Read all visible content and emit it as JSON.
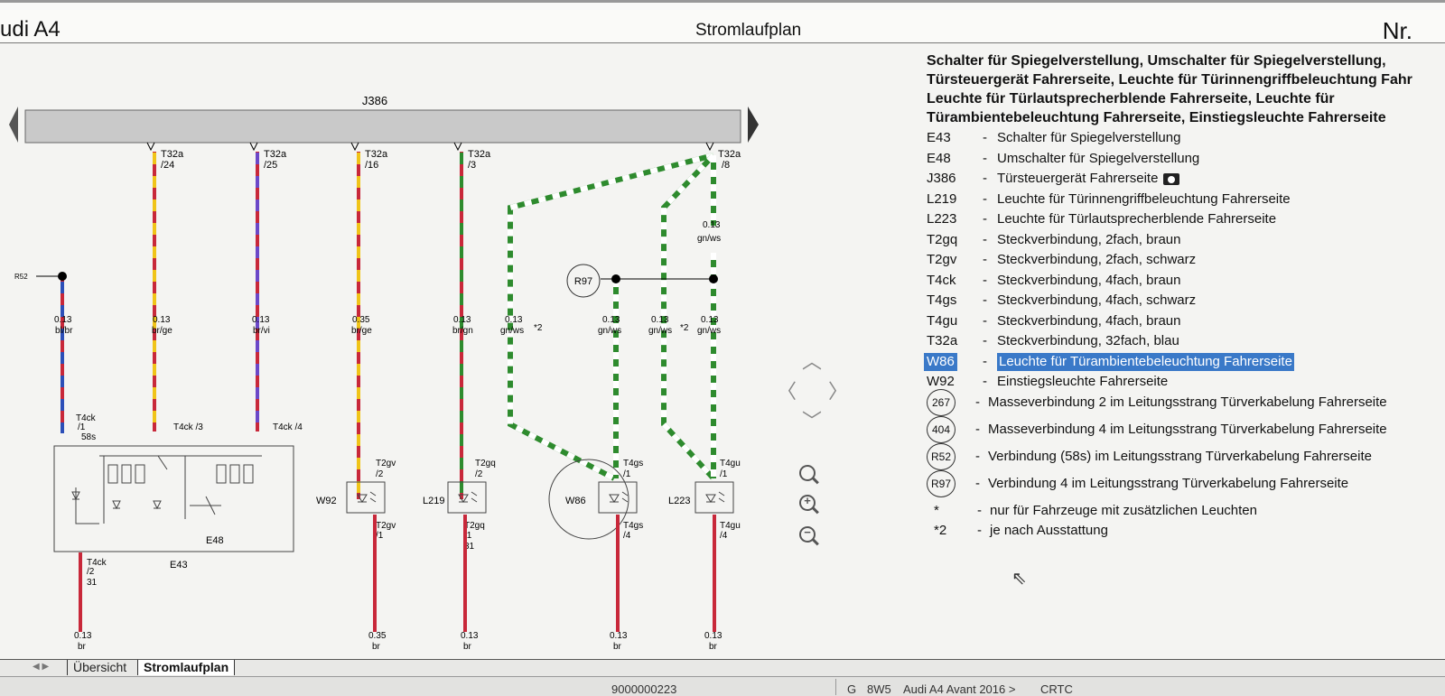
{
  "header": {
    "app_title": "udi A4",
    "doc_title": "Stromlaufplan",
    "doc_nr": "Nr."
  },
  "diagram": {
    "bus_label": "J386",
    "wires": [
      {
        "conn": "T32a",
        "pin": "/24",
        "size": "0.13",
        "color": "br/ge",
        "end": "T4ck /3"
      },
      {
        "conn": "T32a",
        "pin": "/25",
        "size": "0.13",
        "color": "br/vi",
        "end": "T4ck /4"
      },
      {
        "conn": "T32a",
        "pin": "/16",
        "size": "0.35",
        "color": "br/ge"
      },
      {
        "conn": "T32a",
        "pin": "/3",
        "size": "0.13",
        "color": "br/gn"
      },
      {
        "conn": "T32a",
        "pin": "/8"
      }
    ],
    "left_wire": {
      "ref": "R52",
      "size": "0.13",
      "color": "bl/br",
      "conn": "T4ck",
      "pin": "/1",
      "extra": "58s"
    },
    "gnws": [
      {
        "size": "0.13",
        "color": "gn/ws",
        "note": "*2"
      },
      {
        "size": "0.13",
        "color": "gn/ws"
      },
      {
        "size": "0.13",
        "color": "gn/ws",
        "note": "*2"
      },
      {
        "size": "0.13",
        "color": "gn/ws"
      }
    ],
    "top_gnws": {
      "size": "0.13",
      "color": "gn/ws"
    },
    "r97": "R97",
    "components": {
      "e43": "E43",
      "e48": "E48",
      "w92": "W92",
      "l219": "L219",
      "w86": "W86",
      "l223": "L223",
      "t2gv": "T2gv",
      "t2gq": "T2gq",
      "t4gs": "T4gs",
      "t4gu": "T4gu",
      "pin2": "/2",
      "pin1": "/1",
      "pin4": "/4",
      "pin31": "31"
    },
    "bottom_e43": {
      "conn": "T4ck",
      "pin": "/2",
      "ground": "31"
    },
    "bottom": [
      {
        "size": "0.13",
        "color": "br"
      },
      {
        "size": "0.35",
        "color": "br"
      },
      {
        "size": "0.13",
        "color": "br"
      },
      {
        "size": "0.13",
        "color": "br"
      },
      {
        "size": "0.13",
        "color": "br"
      }
    ]
  },
  "legend": {
    "heading": [
      "Schalter für Spiegelverstellung, Umschalter für Spiegelverstellung,",
      "Türsteuergerät Fahrerseite, Leuchte für Türinnengriffbeleuchtung Fahr",
      "Leuchte für Türlautsprecherblende Fahrerseite, Leuchte für",
      "Türambientebeleuchtung Fahrerseite, Einstiegsleuchte Fahrerseite"
    ],
    "items": [
      {
        "code": "E43",
        "desc": "Schalter für Spiegelverstellung"
      },
      {
        "code": "E48",
        "desc": "Umschalter für Spiegelverstellung"
      },
      {
        "code": "J386",
        "desc": "Türsteuergerät Fahrerseite"
      },
      {
        "code": "L219",
        "desc": "Leuchte für Türinnengriffbeleuchtung Fahrerseite"
      },
      {
        "code": "L223",
        "desc": "Leuchte für Türlautsprecherblende Fahrerseite"
      },
      {
        "code": "T2gq",
        "desc": "Steckverbindung, 2fach, braun"
      },
      {
        "code": "T2gv",
        "desc": "Steckverbindung, 2fach, schwarz"
      },
      {
        "code": "T4ck",
        "desc": "Steckverbindung, 4fach, braun"
      },
      {
        "code": "T4gs",
        "desc": "Steckverbindung, 4fach, schwarz"
      },
      {
        "code": "T4gu",
        "desc": "Steckverbindung, 4fach, braun"
      },
      {
        "code": "T32a",
        "desc": "Steckverbindung, 32fach, blau"
      },
      {
        "code": "W86",
        "desc": "Leuchte für Türambientebeleuchtung Fahrerseite"
      },
      {
        "code": "W92",
        "desc": "Einstiegsleuchte Fahrerseite"
      }
    ],
    "circles": [
      {
        "code": "267",
        "desc": "Masseverbindung 2 im Leitungsstrang Türverkabelung Fahrerseite"
      },
      {
        "code": "404",
        "desc": "Masseverbindung 4 im Leitungsstrang Türverkabelung Fahrerseite"
      },
      {
        "code": "R52",
        "desc": "Verbindung (58s) im Leitungsstrang Türverkabelung Fahrerseite"
      },
      {
        "code": "R97",
        "desc": "Verbindung 4 im Leitungsstrang Türverkabelung Fahrerseite"
      }
    ],
    "notes": [
      {
        "code": "*",
        "desc": "nur für Fahrzeuge mit zusätzlichen Leuchten"
      },
      {
        "code": "*2",
        "desc": "je nach Ausstattung"
      }
    ]
  },
  "tabs": [
    "Übersicht",
    "Stromlaufplan"
  ],
  "status": {
    "id": "9000000223",
    "g": "G",
    "code": "8W5",
    "model": "Audi A4 Avant 2016 >",
    "crtc": "CRTC"
  },
  "colors": {
    "brown": "#8b2f2f",
    "red": "#c8283a",
    "yellow": "#f0c419",
    "violet": "#6b48c8",
    "blue": "#2c4fb8",
    "green": "#2e8b2e",
    "white": "#ffffff",
    "highlight": "#3a79c8"
  }
}
